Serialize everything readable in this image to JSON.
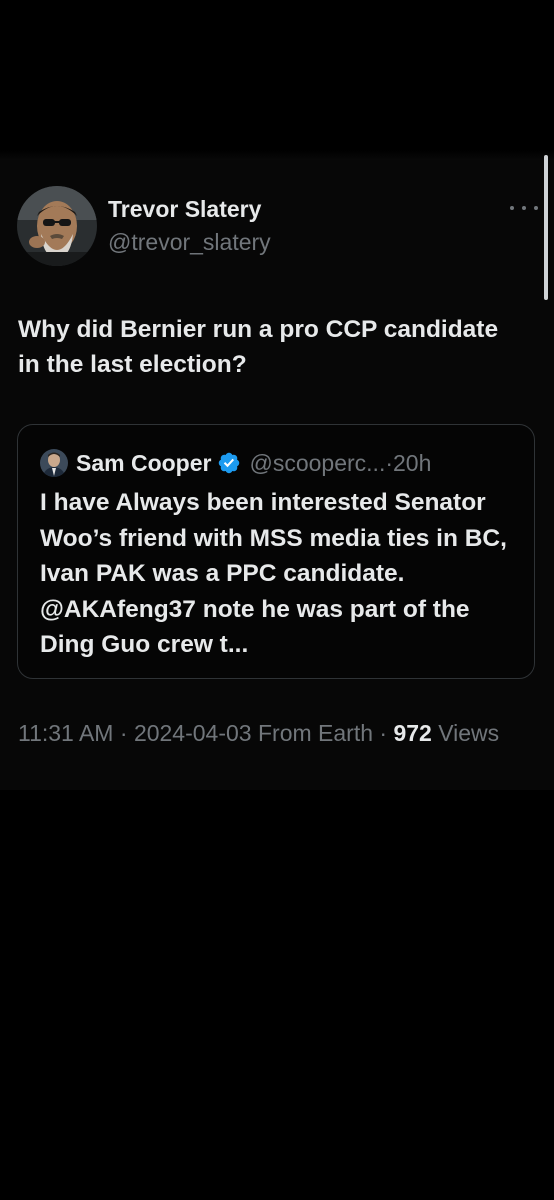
{
  "tweet": {
    "author": {
      "display_name": "Trevor Slatery",
      "handle": "@trevor_slatery"
    },
    "more_icon": "more-horizontal-icon",
    "text": "Why did Bernier run a pro CCP candidate in the last election?",
    "quoted": {
      "display_name": "Sam Cooper",
      "verified_icon": "verified-badge-icon",
      "verified_color": "#1d9bf0",
      "handle": "@scooperc...",
      "separator": "·",
      "time": "20h",
      "text": "I have Always been interested Senator Woo’s friend with MSS media ties in BC, Ivan PAK was a PPC candidate. @AKAfeng37 note he was part of the Ding Guo crew t..."
    },
    "meta": {
      "time": "11:31 AM",
      "separator": "·",
      "date": "2024-04-03",
      "source": "From Earth",
      "views_count": "972",
      "views_label": "Views"
    }
  },
  "colors": {
    "background": "#000000",
    "primary_text": "#e7e9ea",
    "secondary_text": "#71767b",
    "border": "#2f3336",
    "accent": "#1d9bf0"
  }
}
